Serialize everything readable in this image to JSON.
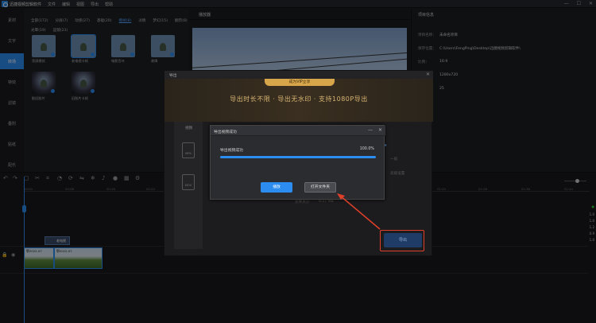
{
  "app": {
    "title": "迅捷视频剪辑软件",
    "menu": [
      "文件",
      "编辑",
      "视图",
      "导出",
      "帮助"
    ],
    "window_controls": [
      "—",
      "☐",
      "✕"
    ]
  },
  "sidebar": {
    "items": [
      {
        "label": "素材",
        "active": false
      },
      {
        "label": "文字",
        "active": false
      },
      {
        "label": "转场",
        "active": true
      },
      {
        "label": "特效",
        "active": false
      },
      {
        "label": "滤镜",
        "active": false
      },
      {
        "label": "叠附",
        "active": false
      },
      {
        "label": "贴纸",
        "active": false
      },
      {
        "label": "配乐",
        "active": false
      }
    ]
  },
  "library": {
    "tabs": [
      {
        "label": "全部(172)",
        "active": false
      },
      {
        "label": "分屏(7)",
        "active": false
      },
      {
        "label": "动感(27)",
        "active": false
      },
      {
        "label": "基础(20)",
        "active": false
      },
      {
        "label": "擦拭(8)",
        "active": true
      },
      {
        "label": "淡情",
        "active": false
      },
      {
        "label": "梦幻(15)",
        "active": false
      },
      {
        "label": "翻页(8)",
        "active": false
      },
      {
        "label": "光晕(19)",
        "active": false
      },
      {
        "label": "运镜(23)",
        "active": false
      }
    ],
    "items": [
      {
        "label": "亮屏擦拭",
        "style": "light"
      },
      {
        "label": "老电视卡帧",
        "style": "light"
      },
      {
        "label": "电影百叶",
        "style": "light"
      },
      {
        "label": "故障",
        "style": "light"
      },
      {
        "label": "脏旧胶片",
        "style": "dark"
      },
      {
        "label": "旧胶片卡帧",
        "style": "dark"
      }
    ]
  },
  "player": {
    "title": "播放器"
  },
  "project_info": {
    "title": "项目信息",
    "rows": [
      {
        "key": "项目名称：",
        "value": "未命名项目"
      },
      {
        "key": "保存位置：",
        "value": "C:\\Users\\FengPing\\Desktop\\迅捷视频剪辑软件\\"
      },
      {
        "key": "比例：",
        "value": "16:9"
      },
      {
        "key": "分辨率：",
        "value": "1280x720"
      },
      {
        "key": "帧率：",
        "value": "25"
      }
    ]
  },
  "timeline": {
    "ticks": [
      "00:00",
      "00:08",
      "00:16",
      "00:24",
      "00:32",
      "01:20",
      "01:28",
      "01:36",
      "01:44"
    ],
    "text_clip": "老电视",
    "video_clip_1": "鄂2022-07",
    "video_clip_2": "鄂2022-07",
    "volume_readouts": [
      "1.0",
      "1.0",
      "1.2",
      "0.9",
      "1.0"
    ]
  },
  "export_dialog": {
    "title": "导出",
    "vip_badge": "成为VIP立享",
    "banner": "导出时长不限 · 导出无水印 · 支持1080P导出",
    "side_label": "视频",
    "formats": [
      "MP4",
      "MOV"
    ],
    "faded_labels": [
      "导出位置",
      "文件大小",
      "9.17 MB",
      "高级设置",
      "一般"
    ],
    "export_button": "导出"
  },
  "success_dialog": {
    "title": "导出视频成功",
    "status": "导出视频成功",
    "percent_text": "100.0%",
    "progress": 1.0,
    "play_button": "播放",
    "open_folder_button": "打开文件夹"
  },
  "colors": {
    "accent": "#2d8cf0",
    "highlight_box": "#e0402a",
    "vip_gold": "#d8a64a"
  }
}
